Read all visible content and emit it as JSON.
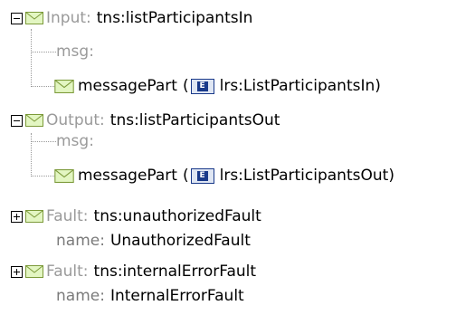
{
  "tree": {
    "input": {
      "label": "Input:",
      "value": "tns:listParticipantsIn",
      "msg": "msg:",
      "part": {
        "name": "messagePart",
        "open": "(",
        "elem_badge": "E",
        "type": "lrs:ListParticipantsIn",
        "close": ")"
      }
    },
    "output": {
      "label": "Output:",
      "value": "tns:listParticipantsOut",
      "msg": "msg:",
      "part": {
        "name": "messagePart",
        "open": "(",
        "elem_badge": "E",
        "type": "lrs:ListParticipantsOut",
        "close": ")"
      }
    },
    "faults": [
      {
        "label": "Fault:",
        "value": "tns:unauthorizedFault",
        "name_label": "name:",
        "name_value": "UnauthorizedFault"
      },
      {
        "label": "Fault:",
        "value": "tns:internalErrorFault",
        "name_label": "name:",
        "name_value": "InternalErrorFault"
      }
    ]
  },
  "icons": {
    "toggle_expanded": "minus-box-icon",
    "toggle_collapsed": "plus-box-icon",
    "message": "envelope-icon",
    "element": "element-icon"
  },
  "colors": {
    "label_gray": "#9a9a9a",
    "envelope_fill": "#e3f6c2",
    "envelope_stroke": "#7c9a3a",
    "element_blue": "#1a3a8a"
  }
}
